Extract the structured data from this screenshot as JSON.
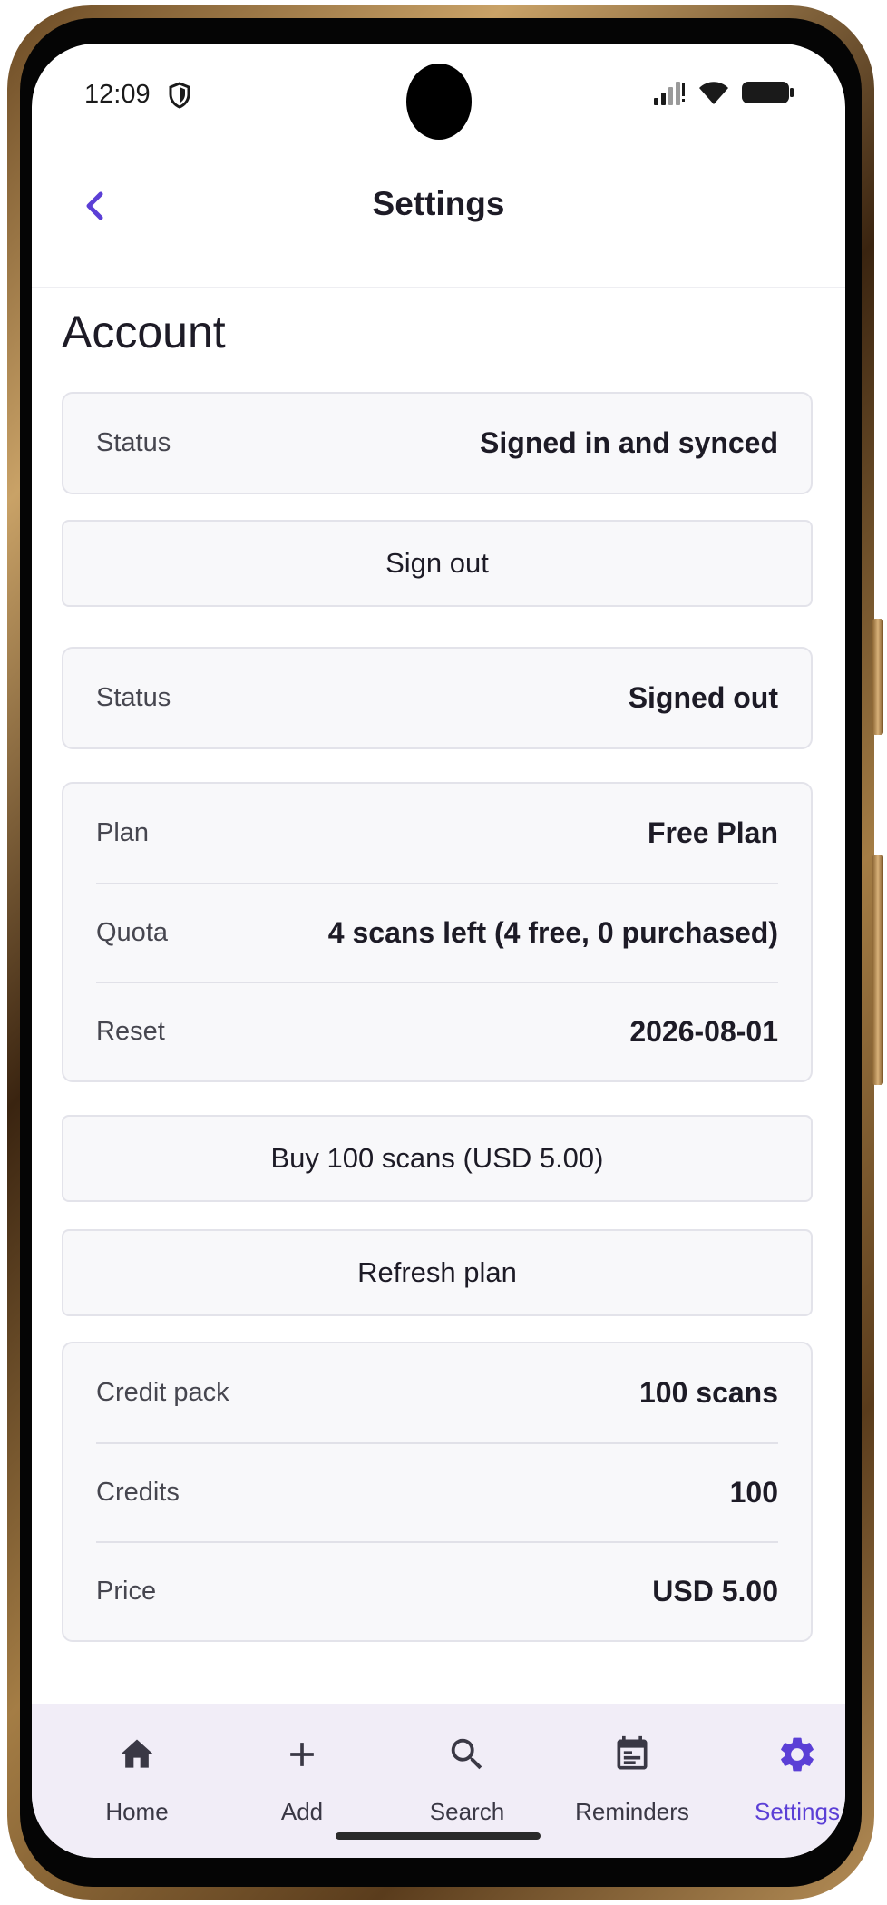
{
  "status_bar": {
    "time": "12:09",
    "icons": [
      "shield-icon",
      "signal-icon",
      "wifi-icon",
      "battery-icon"
    ]
  },
  "app_bar": {
    "title": "Settings",
    "back_icon": "chevron-left-icon"
  },
  "account": {
    "heading": "Account",
    "signed_in_card": {
      "status_label": "Status",
      "status_value": "Signed in and synced"
    },
    "sign_out_label": "Sign out",
    "signed_out_card": {
      "status_label": "Status",
      "status_value": "Signed out"
    },
    "plan_card": {
      "plan_label": "Plan",
      "plan_value": "Free Plan",
      "quota_label": "Quota",
      "quota_value": "4 scans left (4 free, 0 purchased)",
      "reset_label": "Reset",
      "reset_value": "2026-08-01"
    },
    "buy_button_label": "Buy 100 scans (USD 5.00)",
    "refresh_button_label": "Refresh plan",
    "credit_card": {
      "pack_label": "Credit pack",
      "pack_value": "100 scans",
      "credits_label": "Credits",
      "credits_value": "100",
      "price_label": "Price",
      "price_value": "USD 5.00"
    }
  },
  "bottom_nav": {
    "items": [
      {
        "label": "Home",
        "icon": "home-icon"
      },
      {
        "label": "Add",
        "icon": "plus-icon"
      },
      {
        "label": "Search",
        "icon": "search-icon"
      },
      {
        "label": "Reminders",
        "icon": "calendar-icon"
      },
      {
        "label": "Settings",
        "icon": "gear-icon"
      }
    ],
    "active": "Settings"
  },
  "colors": {
    "accent": "#5b3fd6",
    "card_bg": "#f8f8fa",
    "nav_bg": "#f1edf7",
    "text": "#1d1b26"
  }
}
